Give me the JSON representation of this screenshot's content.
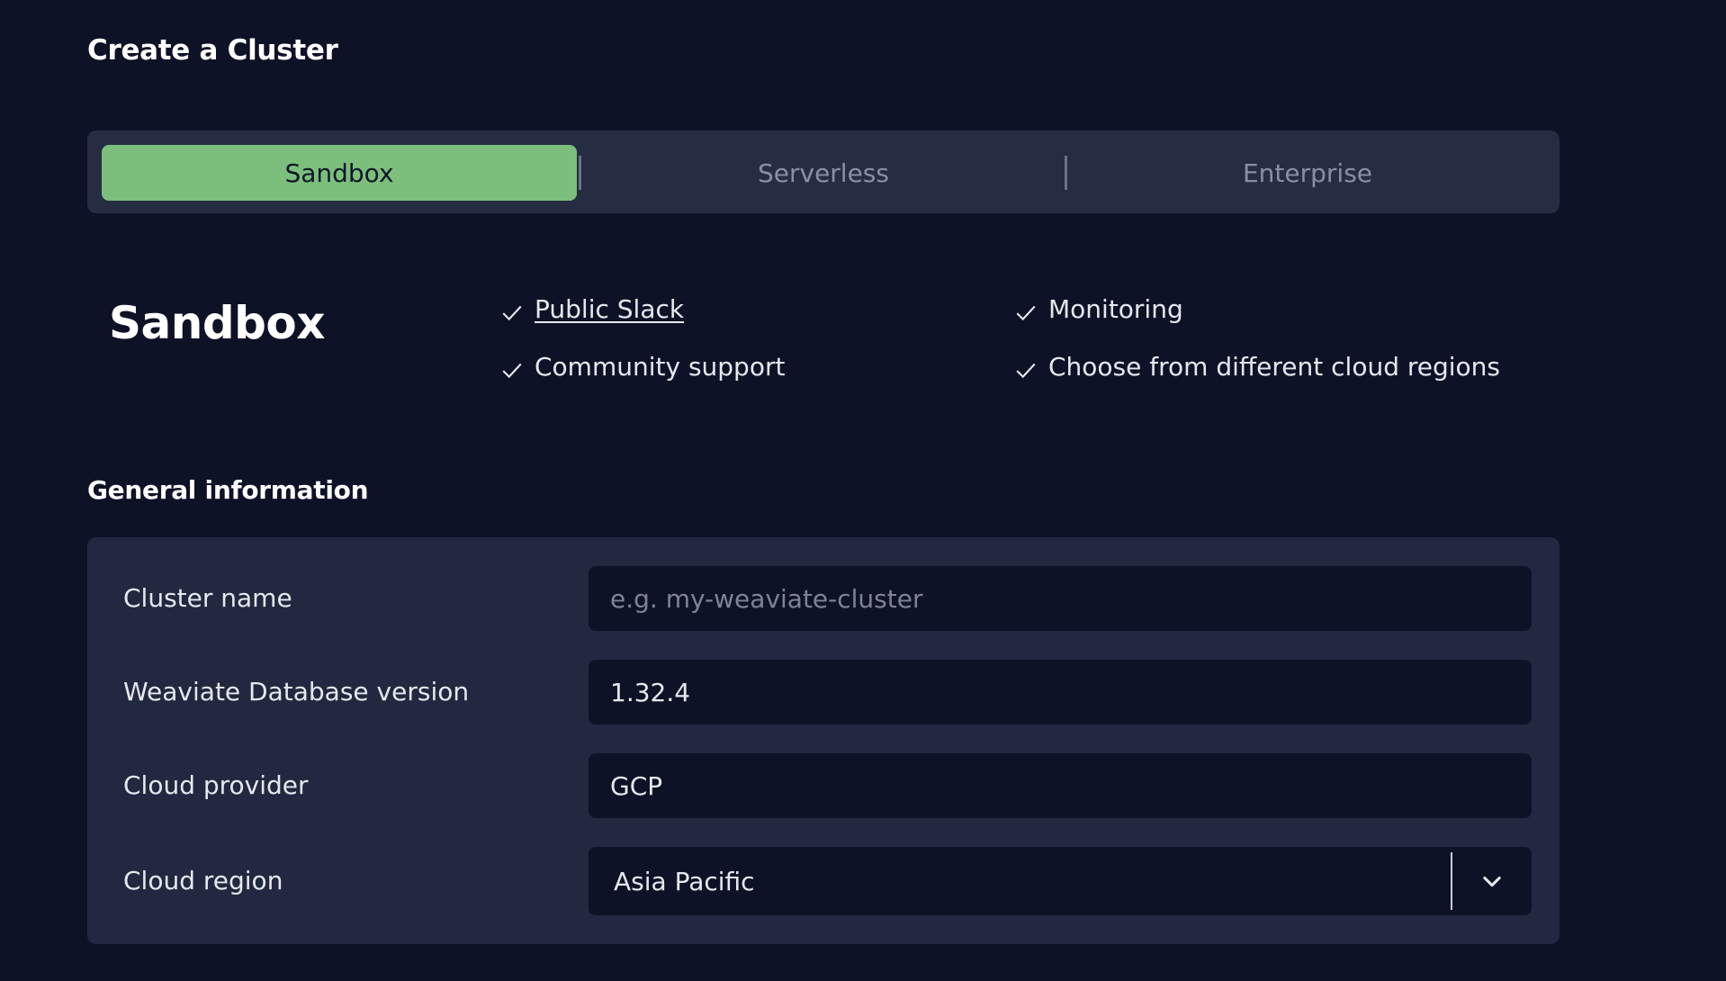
{
  "page": {
    "title": "Create a Cluster"
  },
  "tiers": {
    "tabs": [
      {
        "label": "Sandbox",
        "active": true
      },
      {
        "label": "Serverless",
        "active": false
      },
      {
        "label": "Enterprise",
        "active": false
      }
    ]
  },
  "tier_summary": {
    "heading": "Sandbox",
    "features": [
      {
        "label": "Public Slack",
        "link": true
      },
      {
        "label": "Monitoring",
        "link": false
      },
      {
        "label": "Community support",
        "link": false
      },
      {
        "label": "Choose from different cloud regions",
        "link": false
      }
    ],
    "check_icon": "check-icon"
  },
  "general_information": {
    "title": "General information",
    "fields": {
      "cluster_name": {
        "label": "Cluster name",
        "value": "",
        "placeholder": "e.g. my-weaviate-cluster"
      },
      "db_version": {
        "label": "Weaviate Database version",
        "value": "1.32.4"
      },
      "cloud_provider": {
        "label": "Cloud provider",
        "value": "GCP"
      },
      "cloud_region": {
        "label": "Cloud region",
        "value": "Asia Pacific",
        "icon": "chevron-down-icon"
      }
    }
  },
  "colors": {
    "background": "#0d1227",
    "panel": "#212840",
    "tab_bar": "#262c42",
    "accent": "#7cbf7c"
  }
}
